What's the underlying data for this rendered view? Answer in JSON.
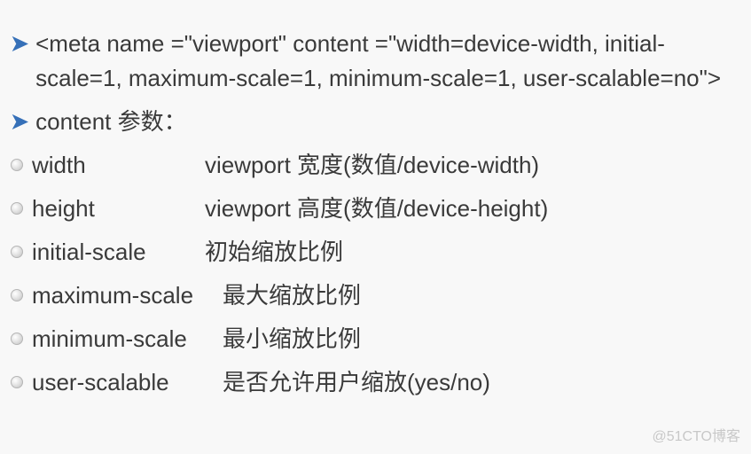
{
  "blocks": {
    "meta_tag": "<meta name =\"viewport\" content =\"width=device-width, initial-scale=1, maximum-scale=1, minimum-scale=1, user-scalable=no\">",
    "content_label": "content 参数："
  },
  "params": [
    {
      "name": "width",
      "desc": "viewport 宽度(数值/device-width)"
    },
    {
      "name": "height",
      "desc": "viewport 高度(数值/device-height)"
    },
    {
      "name": "initial-scale",
      "desc": "初始缩放比例"
    },
    {
      "name": "maximum-scale",
      "desc": "最大缩放比例"
    },
    {
      "name": "minimum-scale",
      "desc": "最小缩放比例"
    },
    {
      "name": "user-scalable",
      "desc": "是否允许用户缩放(yes/no)"
    }
  ],
  "watermark": "@51CTO博客"
}
